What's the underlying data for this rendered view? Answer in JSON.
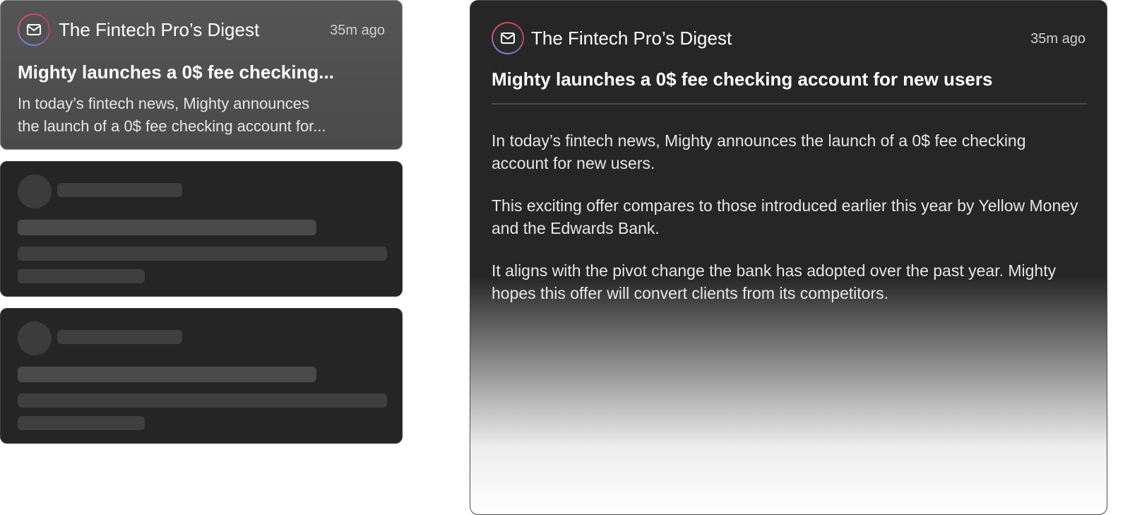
{
  "inbox": {
    "selected": {
      "sender": "The Fintech Pro’s Digest",
      "time": "35m ago",
      "subject": "Mighty launches a 0$ fee checking...",
      "preview_line1": "In today’s fintech news, Mighty announces",
      "preview_line2": "the launch of a 0$ fee checking account for..."
    }
  },
  "message": {
    "sender": "The Fintech Pro’s Digest",
    "time": "35m ago",
    "subject": "Mighty launches a 0$ fee checking account for new users",
    "paragraphs": [
      "In today’s fintech news, Mighty announces the launch of a 0$ fee checking account for new users.",
      "This exciting offer compares to those introduced earlier this year by Yellow Money and the Edwards Bank.",
      "It aligns with the pivot change the bank has adopted over the past year. Mighty hopes this offer will convert clients from its competitors."
    ]
  },
  "icons": {
    "sender_avatar": "mail-icon"
  },
  "colors": {
    "background": "#ffffff",
    "panel": "#262626",
    "card_active": "#505050",
    "skeleton": "#4a4a4a",
    "avatar_ring_start": "#e04a5a",
    "avatar_ring_end": "#6c86e8"
  }
}
